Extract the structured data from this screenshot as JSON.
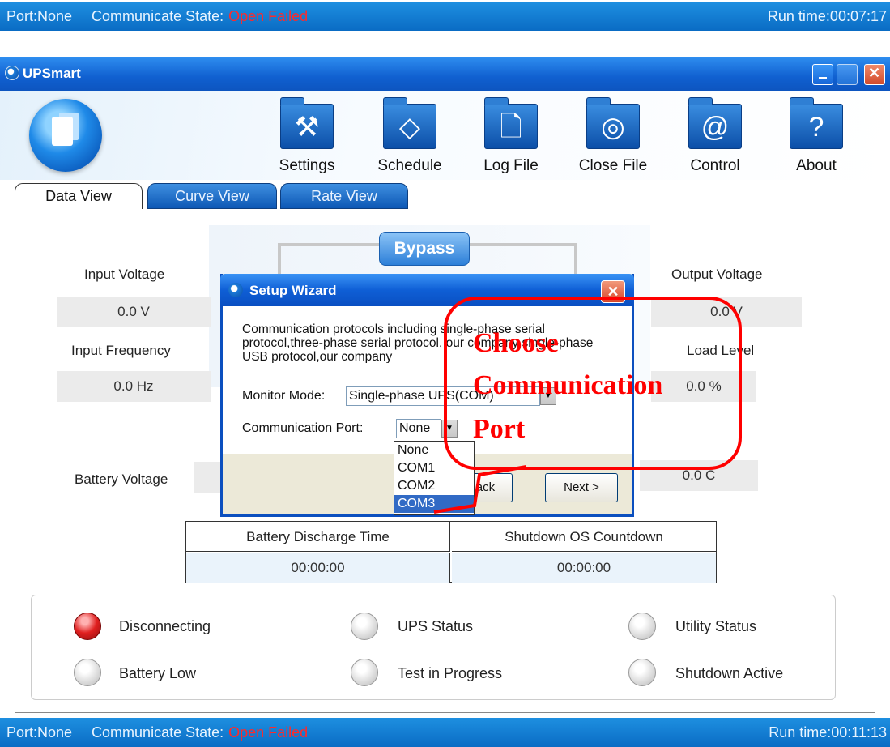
{
  "status_top": {
    "port": "Port:None",
    "comm_label": "Communicate State:",
    "comm_state": "Open Failed",
    "run_time": "Run time:00:07:17"
  },
  "status_bottom": {
    "port": "Port:None",
    "comm_label": "Communicate State:",
    "comm_state": "Open Failed",
    "run_time": "Run time:00:11:13"
  },
  "window": {
    "title": "UPSmart"
  },
  "toolbar": [
    {
      "label": "Settings",
      "icon": "hammer-icon"
    },
    {
      "label": "Schedule",
      "icon": "eraser-icon"
    },
    {
      "label": "Log File",
      "icon": "file-icon"
    },
    {
      "label": "Close File",
      "icon": "disc-icon"
    },
    {
      "label": "Control",
      "icon": "at-icon"
    },
    {
      "label": "About",
      "icon": "question-icon"
    }
  ],
  "tabs": [
    {
      "label": "Data View",
      "active": true
    },
    {
      "label": "Curve View",
      "active": false
    },
    {
      "label": "Rate View",
      "active": false
    }
  ],
  "data": {
    "input_voltage_label": "Input Voltage",
    "input_voltage": "0.0 V",
    "input_frequency_label": "Input Frequency",
    "input_frequency": "0.0 Hz",
    "battery_voltage_label": "Battery Voltage",
    "output_voltage_label": "Output Voltage",
    "output_voltage": "0.0 V",
    "load_level_label": "Load Level",
    "load_level": "0.0 %",
    "temperature": "0.0 C",
    "bypass": "Bypass"
  },
  "discharge": {
    "battery_label": "Battery Discharge Time",
    "battery_value": "00:00:00",
    "shutdown_label": "Shutdown OS Countdown",
    "shutdown_value": "00:00:00"
  },
  "indicators": [
    {
      "label": "Disconnecting",
      "on": true
    },
    {
      "label": "UPS Status",
      "on": false
    },
    {
      "label": "Utility Status",
      "on": false
    },
    {
      "label": "Battery Low",
      "on": false
    },
    {
      "label": "Test in Progress",
      "on": false
    },
    {
      "label": "Shutdown Active",
      "on": false
    }
  ],
  "dialog": {
    "title": "Setup Wizard",
    "description": "Communication protocols including single-phase serial protocol,three-phase serial protocol, our company single-phase USB protocol,our company",
    "monitor_mode_label": "Monitor Mode:",
    "monitor_mode_value": "Single-phase UPS(COM)",
    "comm_port_label": "Communication Port:",
    "comm_port_value": "None",
    "back_label": "< Back",
    "next_label": "Next >",
    "port_options": [
      "None",
      "COM1",
      "COM2",
      "COM3"
    ],
    "port_highlighted": "COM3"
  },
  "annotation": {
    "lines": [
      "Choose",
      "Communication",
      "Port"
    ],
    "color": "#ff0000"
  },
  "colors": {
    "accent_blue": "#0d58b5",
    "status_fail": "#ff2a2a",
    "led_on": "#e02020"
  }
}
